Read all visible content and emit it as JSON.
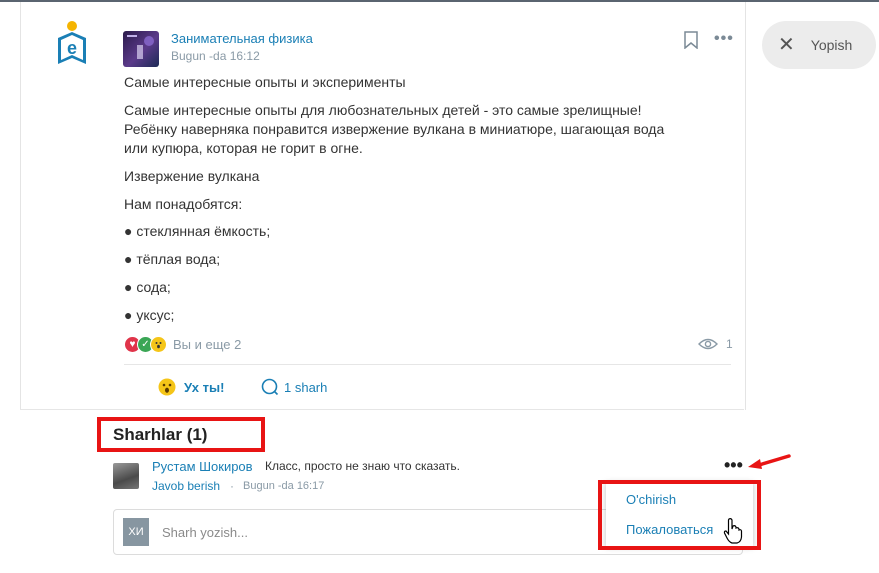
{
  "post": {
    "group_name": "Занимательная физика",
    "time": "Bugun -da 16:12",
    "paragraphs": [
      "Самые интересные опыты и эксперименты",
      "Самые интересные опыты для любознательных детей - это самые зрелищные!",
      "Ребёнку наверняка понравится извержение вулкана в миниатюре, шагающая вода",
      "или купюра, которая не горит в огне.",
      "Извержение вулкана",
      "Нам понадобятся:",
      "● стеклянная ёмкость;",
      "● тёплая вода;",
      "● сода;",
      "● уксус;"
    ],
    "reactions_text": "Вы и еще 2",
    "views": "1",
    "reaction_label": "Ух ты!",
    "comments_link": "1 sharh"
  },
  "close": {
    "label": "Yopish"
  },
  "comments": {
    "title": "Sharhlar (1)",
    "items": [
      {
        "author": "Рустам Шокиров",
        "text": "Класс, просто не знаю что сказать.",
        "reply": "Javob berish",
        "separator": "·",
        "time": "Bugun -da 16:17"
      }
    ],
    "menu": {
      "delete": "O'chirish",
      "report": "Пожаловаться"
    },
    "input": {
      "avatar_initials": "ХИ",
      "placeholder": "Sharh yozish..."
    }
  },
  "colors": {
    "accent": "#1a7fb5",
    "highlight": "#e81414",
    "muted": "#8a9aa6"
  },
  "icons": [
    "logo-icon",
    "bookmark-icon",
    "more-icon",
    "close-icon",
    "eye-icon",
    "wow-icon",
    "comment-icon",
    "cursor-icon",
    "arrow-icon"
  ]
}
